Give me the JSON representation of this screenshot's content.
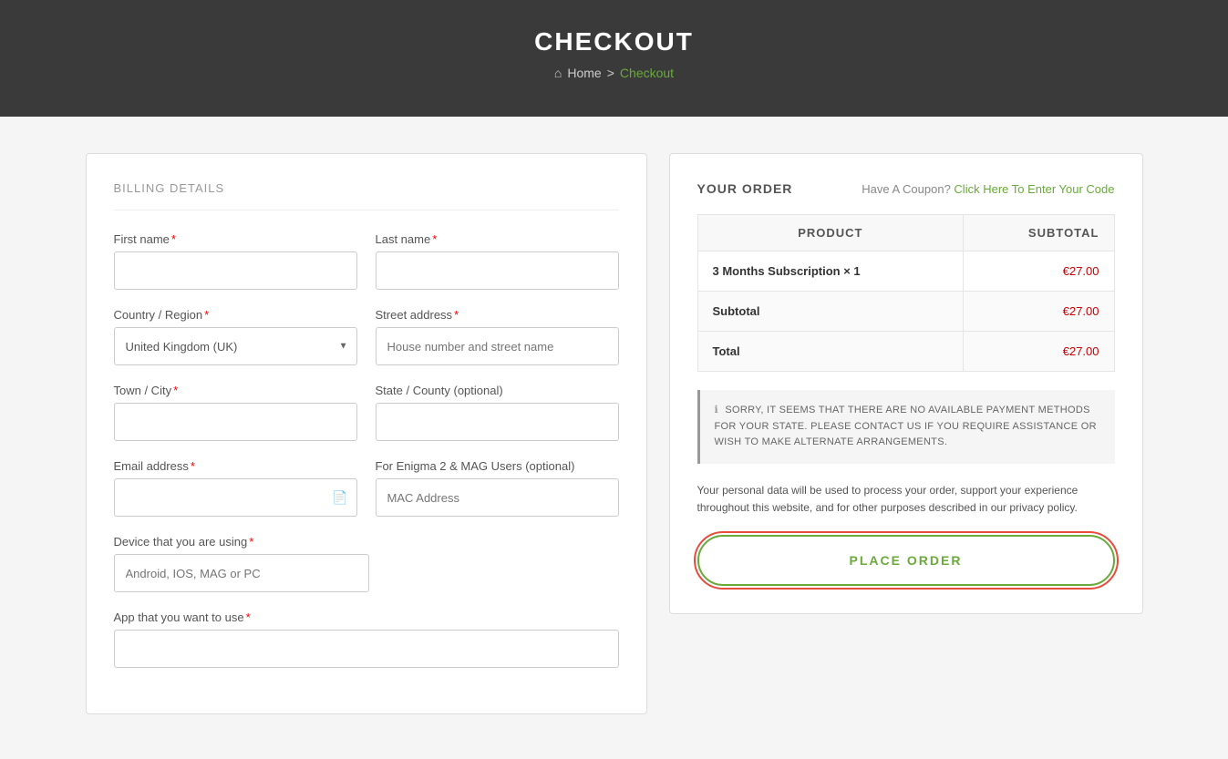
{
  "header": {
    "title": "CHECKOUT",
    "breadcrumb": {
      "home_label": "Home",
      "separator": ">",
      "current": "Checkout"
    }
  },
  "billing": {
    "section_title": "BILLING DETAILS",
    "fields": {
      "first_name": {
        "label": "First name",
        "required": true,
        "placeholder": "",
        "value": ""
      },
      "last_name": {
        "label": "Last name",
        "required": true,
        "placeholder": "",
        "value": ""
      },
      "country": {
        "label": "Country / Region",
        "required": true,
        "value": "United Kingdom (UK)"
      },
      "street_address": {
        "label": "Street address",
        "required": true,
        "placeholder": "House number and street name",
        "value": ""
      },
      "town": {
        "label": "Town / City",
        "required": true,
        "placeholder": "",
        "value": ""
      },
      "state": {
        "label": "State / County (optional)",
        "required": false,
        "placeholder": "",
        "value": ""
      },
      "email": {
        "label": "Email address",
        "required": true,
        "placeholder": "",
        "value": ""
      },
      "mac_address": {
        "label": "For Enigma 2 & MAG Users (optional)",
        "required": false,
        "placeholder": "MAC Address",
        "value": ""
      },
      "device": {
        "label": "Device that you are using",
        "required": true,
        "placeholder": "Android, IOS, MAG or PC",
        "value": ""
      },
      "app": {
        "label": "App that you want to use",
        "required": true,
        "placeholder": "",
        "value": ""
      }
    }
  },
  "order": {
    "title": "YOUR ORDER",
    "coupon_text": "Have A Coupon?",
    "coupon_link": "Click Here To Enter Your Code",
    "table": {
      "columns": [
        "PRODUCT",
        "SUBTOTAL"
      ],
      "rows": [
        {
          "product": "3 Months Subscription × 1",
          "subtotal": "€27.00"
        }
      ],
      "subtotal_label": "Subtotal",
      "subtotal_value": "€27.00",
      "total_label": "Total",
      "total_value": "€27.00"
    },
    "warning": "SORRY, IT SEEMS THAT THERE ARE NO AVAILABLE PAYMENT METHODS FOR YOUR STATE. PLEASE CONTACT US IF YOU REQUIRE ASSISTANCE OR WISH TO MAKE ALTERNATE ARRANGEMENTS.",
    "privacy_text": "Your personal data will be used to process your order, support your experience throughout this website, and for other purposes described in our privacy policy.",
    "place_order_label": "PLACE ORDER"
  }
}
